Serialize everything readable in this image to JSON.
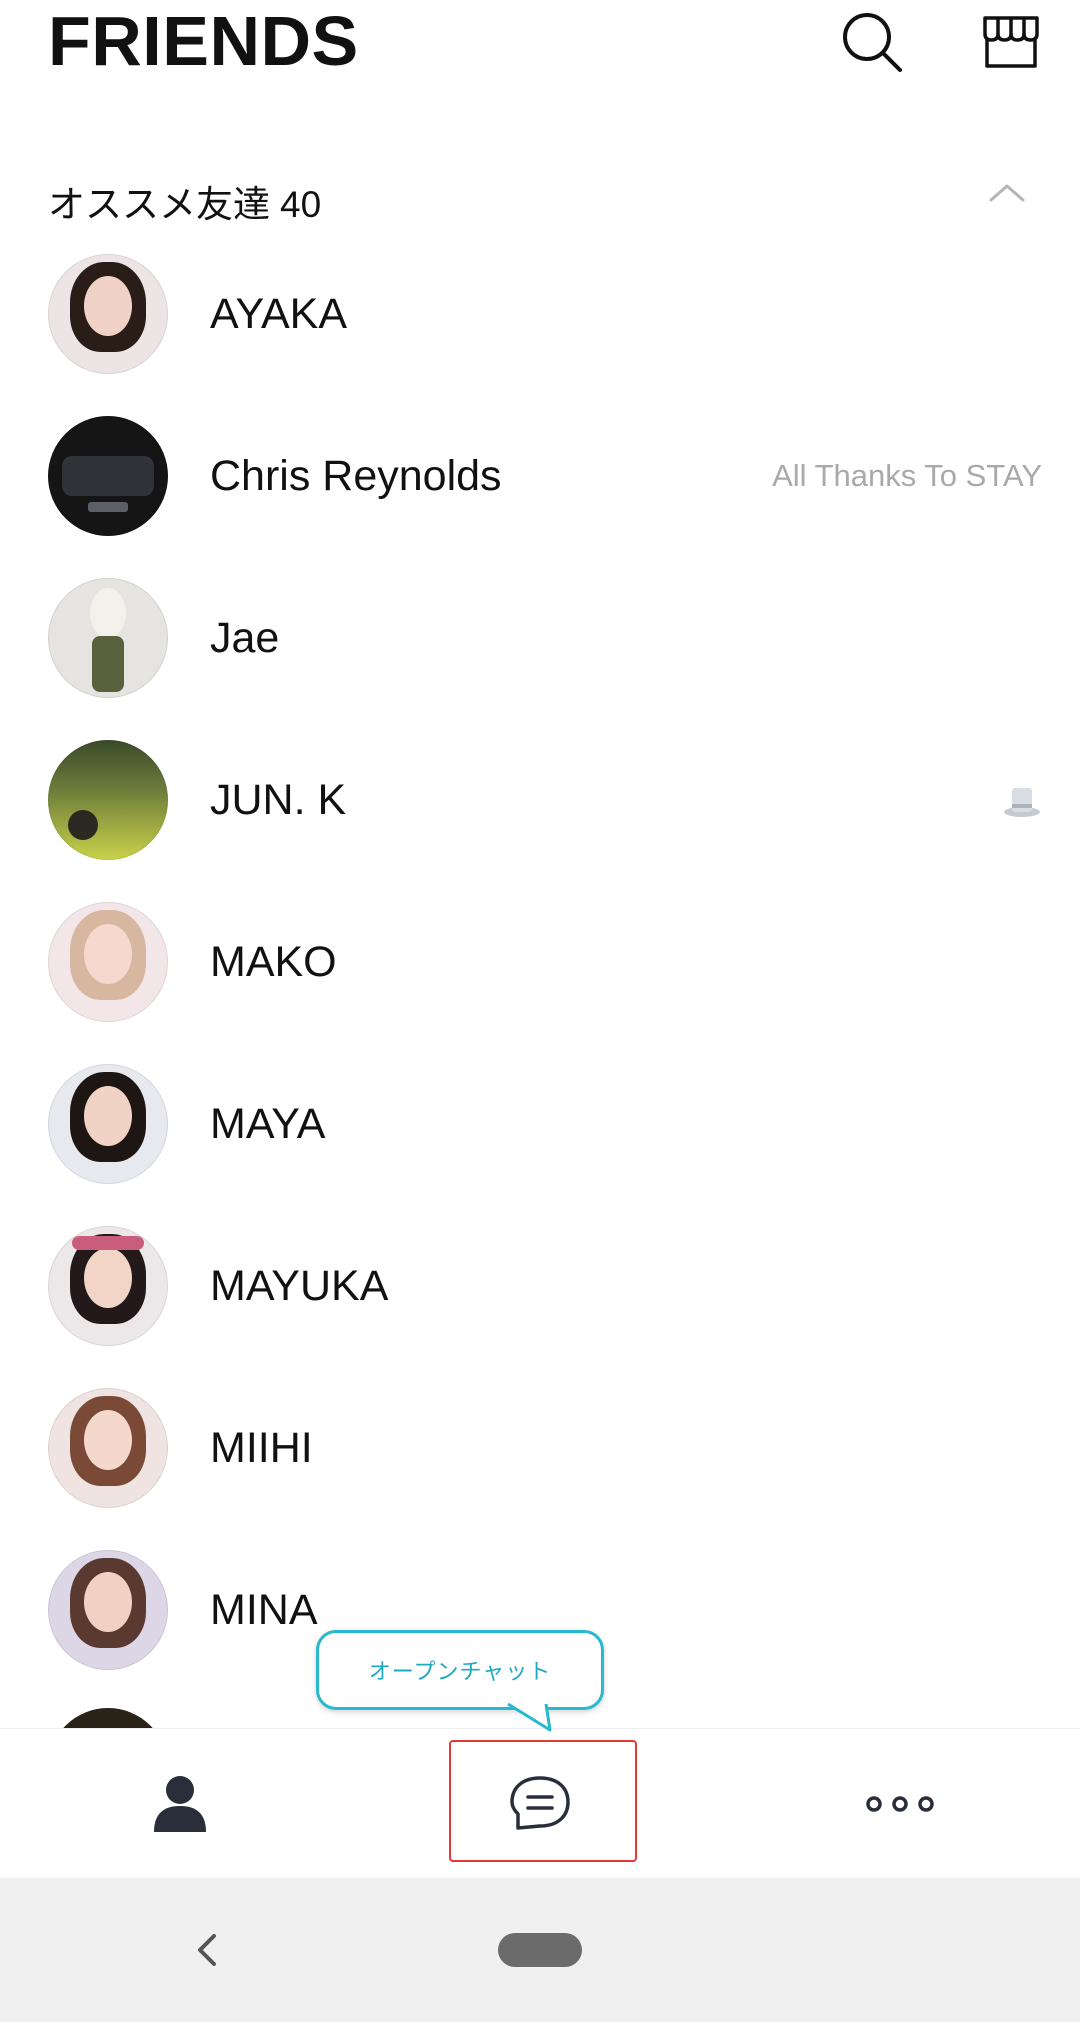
{
  "header": {
    "title": "FRIENDS",
    "search_icon": "search-icon",
    "shop_icon": "shop-icon"
  },
  "section": {
    "title": "オススメ友達",
    "count": "40",
    "collapse_icon": "chevron-up-icon"
  },
  "friends": [
    {
      "name": "AYAKA",
      "status": ""
    },
    {
      "name": "Chris Reynolds",
      "status": "All Thanks To STAY"
    },
    {
      "name": "Jae",
      "status": ""
    },
    {
      "name": "JUN. K",
      "status": "",
      "status_icon": "top-hat-icon"
    },
    {
      "name": "MAKO",
      "status": ""
    },
    {
      "name": "MAYA",
      "status": ""
    },
    {
      "name": "MAYUKA",
      "status": ""
    },
    {
      "name": "MIIHI",
      "status": ""
    },
    {
      "name": "MINA",
      "status": ""
    }
  ],
  "tooltip": {
    "text": "オープンチャット"
  },
  "bottom_nav": {
    "items": [
      {
        "icon": "person-icon"
      },
      {
        "icon": "chat-bubble-icon"
      },
      {
        "icon": "more-dots-icon"
      }
    ]
  },
  "system_nav": {
    "back_icon": "back-chevron-icon",
    "home_icon": "home-pill-icon"
  },
  "colors": {
    "accent_tooltip": "#28b8cf",
    "highlight": "#e53935",
    "status_text": "#a9a9a9"
  }
}
